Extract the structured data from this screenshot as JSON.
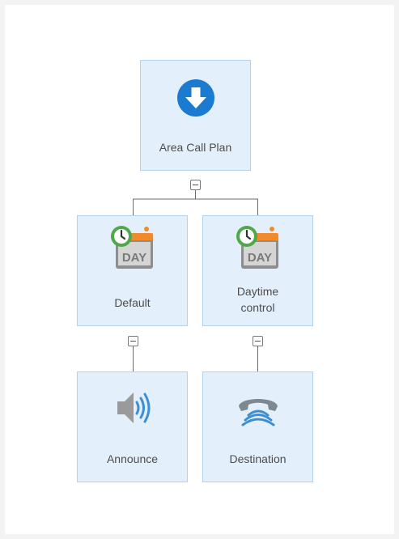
{
  "tree": {
    "root": {
      "label": "Area Call Plan",
      "icon": "download-arrow-icon"
    },
    "children": [
      {
        "label": "Default",
        "icon": "day-clock-calendar-icon",
        "day_text": "DAY",
        "child": {
          "label": "Announce",
          "icon": "speaker-icon"
        }
      },
      {
        "label": "Daytime\ncontrol",
        "icon": "day-clock-calendar-icon",
        "day_text": "DAY",
        "child": {
          "label": "Destination",
          "icon": "telephone-receiver-icon"
        }
      }
    ]
  },
  "colors": {
    "node_fill": "#e3effa",
    "node_border": "#b3d2ec",
    "arrow_blue": "#1a7bd1",
    "clock_green": "#4fa84a",
    "calendar_orange": "#f08a2b",
    "speaker_blue": "#3c8fd4",
    "phone_gray": "#7d8891"
  }
}
